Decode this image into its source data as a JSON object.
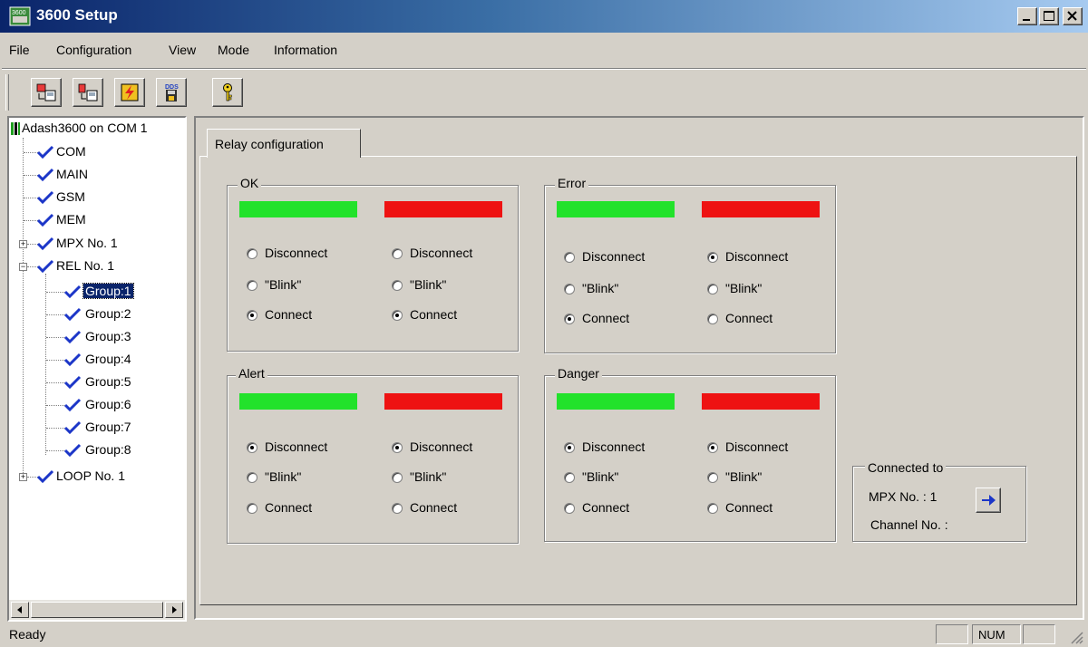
{
  "window": {
    "title": "3600 Setup"
  },
  "menu": [
    {
      "label": "File"
    },
    {
      "label": "Configuration"
    },
    {
      "label": "View"
    },
    {
      "label": "Mode"
    },
    {
      "label": "Information"
    }
  ],
  "toolbar": {
    "icons": [
      "connect-icon",
      "disconnect-icon",
      "flash-icon",
      "dds-save-icon",
      "help-key-icon"
    ]
  },
  "tree": {
    "root": "Adash3600 on COM 1",
    "items": [
      "COM",
      "MAIN",
      "GSM",
      "MEM",
      "MPX No. 1",
      "REL No. 1",
      "Group:1",
      "Group:2",
      "Group:3",
      "Group:4",
      "Group:5",
      "Group:6",
      "Group:7",
      "Group:8",
      "LOOP No. 1"
    ],
    "selected": "Group:1"
  },
  "tab": {
    "label": "Relay configuration"
  },
  "options": {
    "disconnect": "Disconnect",
    "blink": "\"Blink\"",
    "connect": "Connect"
  },
  "groups": {
    "ok": {
      "title": "OK",
      "green": "connect",
      "red": "connect"
    },
    "error": {
      "title": "Error",
      "green": "connect",
      "red": "disconnect"
    },
    "alert": {
      "title": "Alert",
      "green": "disconnect",
      "red": "disconnect"
    },
    "danger": {
      "title": "Danger",
      "green": "disconnect",
      "red": "disconnect"
    }
  },
  "colors": {
    "green": "#22e22b",
    "red": "#ee1212"
  },
  "connected": {
    "title": "Connected to",
    "mpx": "MPX No. : 1",
    "channel": "Channel No. :"
  },
  "status": {
    "text": "Ready",
    "num": "NUM"
  }
}
